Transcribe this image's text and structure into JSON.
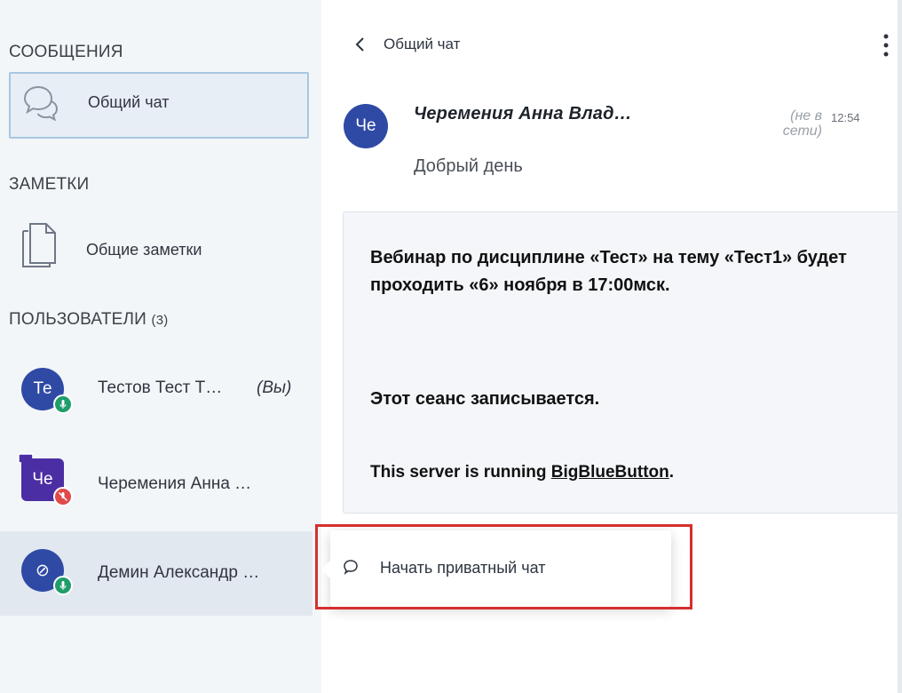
{
  "sidebar": {
    "messages_title": "СООБЩЕНИЯ",
    "public_chat_label": "Общий чат",
    "notes_title": "ЗАМЕТКИ",
    "shared_notes_label": "Общие заметки",
    "users_title": "ПОЛЬЗОВАТЕЛИ",
    "users_count": "(3)",
    "users": [
      {
        "initials": "Те",
        "name": "Тестов Тест Т…",
        "you": "(Вы)",
        "avatar_color": "#2f4aa5",
        "status_color": "#1f9d6b"
      },
      {
        "initials": "Че",
        "name": "Черемения Анна …",
        "avatar_color": "#4b2ea4",
        "status_color": "#e04a4a"
      },
      {
        "initials": "⊘",
        "name": "Демин Александр …",
        "avatar_color": "#2f4aa5",
        "status_color": "#1f9d6b"
      }
    ]
  },
  "chat": {
    "title": "Общий чат",
    "message": {
      "initials": "Че",
      "author": "Черемения Анна Влад…",
      "status": "(не в сети)",
      "time": "12:54",
      "text": "Добрый день"
    },
    "welcome": {
      "text": "Вебинар по дисциплине «Тест» на тему «Тест1» будет проходить «6» ноября в 17:00мск.",
      "recording": "Этот сеанс записывается.",
      "server_prefix": "This server is running ",
      "server_link": "BigBlueButton",
      "server_suffix": "."
    }
  },
  "popup": {
    "label": "Начать приватный чат"
  },
  "colors": {
    "highlight": "#d62f2f",
    "avatar_blue": "#2f4aa5",
    "avatar_purple": "#4b2ea4"
  },
  "icons": [
    "chat-bubbles-icon",
    "notes-icon",
    "back-icon",
    "kebab-menu-icon",
    "speech-bubble-icon",
    "presenter-icon",
    "microphone-icon",
    "muted-microphone-icon"
  ]
}
